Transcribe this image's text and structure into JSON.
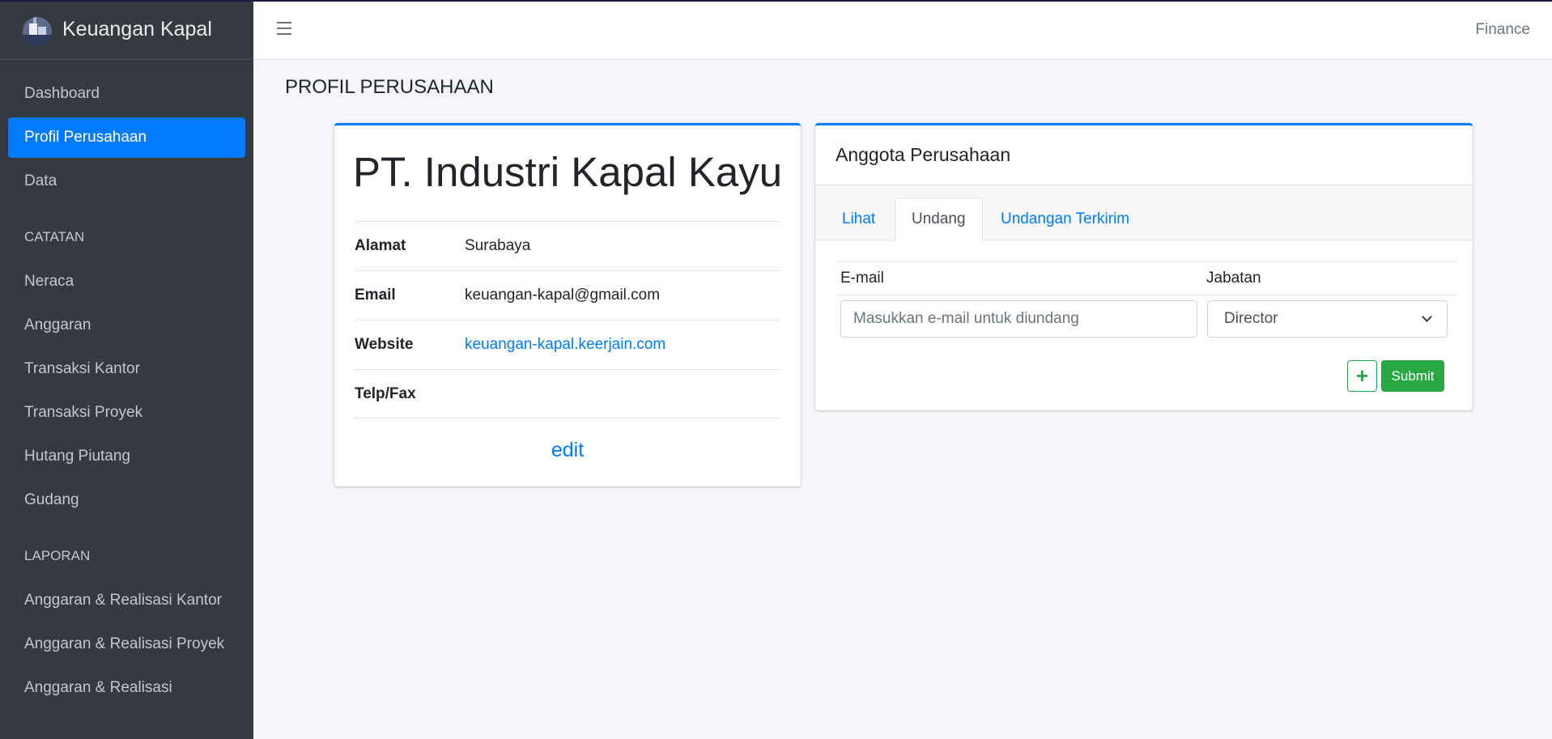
{
  "app": {
    "brand": "Keuangan Kapal",
    "user_role": "Finance"
  },
  "sidebar": {
    "main_items": [
      {
        "label": "Dashboard"
      },
      {
        "label": "Profil Perusahaan",
        "active": true
      },
      {
        "label": "Data"
      }
    ],
    "sections": [
      {
        "header": "CATATAN",
        "items": [
          {
            "label": "Neraca"
          },
          {
            "label": "Anggaran"
          },
          {
            "label": "Transaksi Kantor"
          },
          {
            "label": "Transaksi Proyek"
          },
          {
            "label": "Hutang Piutang"
          },
          {
            "label": "Gudang"
          }
        ]
      },
      {
        "header": "LAPORAN",
        "items": [
          {
            "label": "Anggaran & Realisasi Kantor"
          },
          {
            "label": "Anggaran & Realisasi Proyek"
          },
          {
            "label": "Anggaran & Realisasi"
          }
        ]
      }
    ]
  },
  "page": {
    "title": "PROFIL PERUSAHAAN"
  },
  "profile": {
    "company_name": "PT. Industri Kapal Kayu",
    "rows": [
      {
        "label": "Alamat",
        "value": "Surabaya"
      },
      {
        "label": "Email",
        "value": "keuangan-kapal@gmail.com"
      },
      {
        "label": "Website",
        "value": "keuangan-kapal.keerjain.com"
      },
      {
        "label": "Telp/Fax",
        "value": ""
      }
    ],
    "edit_label": "edit"
  },
  "members": {
    "title": "Anggota Perusahaan",
    "tabs": [
      {
        "label": "Lihat"
      },
      {
        "label": "Undang",
        "active": true
      },
      {
        "label": "Undangan Terkirim"
      }
    ],
    "form": {
      "email_header": "E-mail",
      "role_header": "Jabatan",
      "email_placeholder": "Masukkan e-mail untuk diundang",
      "email_value": "",
      "role_selected": "Director",
      "add_label": "+",
      "submit_label": "Submit"
    }
  },
  "colors": {
    "primary": "#007bff",
    "success": "#28a745",
    "sidebar_bg": "#343a40"
  }
}
